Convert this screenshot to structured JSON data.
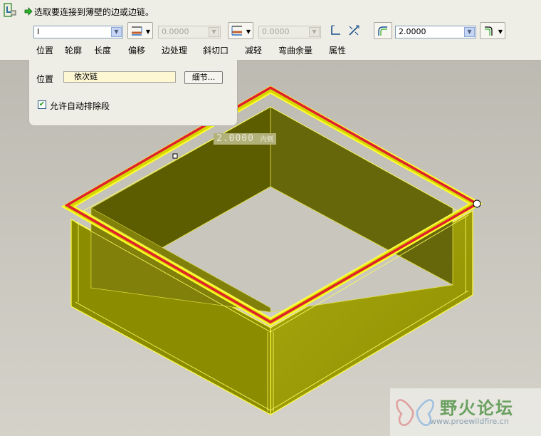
{
  "toolbar": {
    "prompt": "选取要连接到薄壁的边或边链。",
    "wall_type_value": "I",
    "length_value_1": "0.0000",
    "length_value_2": "0.0000",
    "thickness_value": "2.0000"
  },
  "tabs": [
    "位置",
    "轮廓",
    "长度",
    "偏移",
    "边处理",
    "斜切口",
    "减轻",
    "弯曲余量",
    "属性"
  ],
  "panel": {
    "position_label": "位置",
    "chain_value": "依次链",
    "details_button": "细节...",
    "auto_exclude_label": "允许自动排除段",
    "auto_exclude_checked": true
  },
  "viewport": {
    "dim_value": "2.0000",
    "dim_side": "内侧"
  },
  "watermark": {
    "title": "野火论坛",
    "url": "www.proewildfire.cn"
  },
  "colors": {
    "solid_yellow": "#c8c800",
    "edge_highlight": "#e0202e",
    "toolbar_bg": "#efeee6"
  },
  "icons": [
    "sheetmetal-feature-icon",
    "green-arrow-icon",
    "wall-height-icon",
    "offset-icon",
    "flip-icon",
    "thickness-icon",
    "bend-radius-icon"
  ]
}
